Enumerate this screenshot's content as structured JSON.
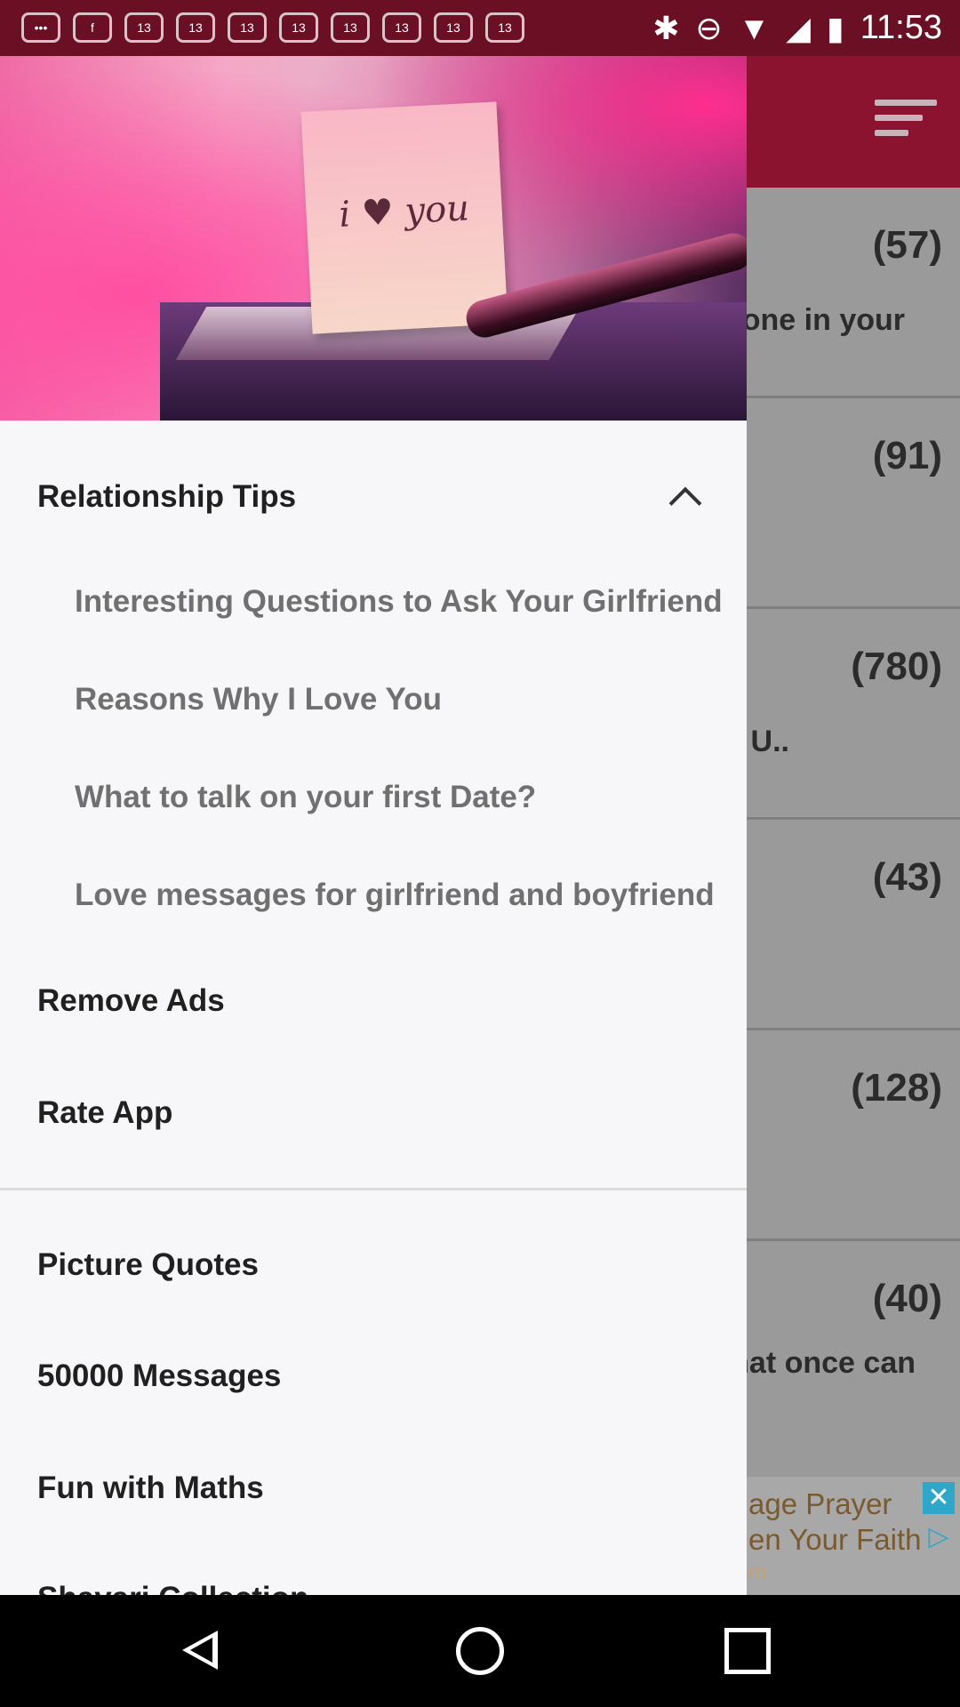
{
  "status_bar": {
    "notification_icons": [
      "more-icon",
      "facebook-icon",
      "abc13-icon",
      "abc13-icon",
      "abc13-icon",
      "abc13-icon",
      "abc13-icon",
      "abc13-icon",
      "abc13-icon",
      "abc13-icon"
    ],
    "notification_label": "13",
    "time": "11:53"
  },
  "background_list": [
    {
      "count": "(57)",
      "snippet": "one in your"
    },
    {
      "count": "(91)",
      "snippet": ""
    },
    {
      "count": "(780)",
      "snippet": "U.."
    },
    {
      "count": "(43)",
      "snippet": ""
    },
    {
      "count": "(128)",
      "snippet": ""
    },
    {
      "count": "(40)",
      "snippet": "hat once can"
    }
  ],
  "ad": {
    "line1": "age Prayer",
    "line2": "en Your Faith",
    "line3": "m"
  },
  "drawer": {
    "hero_note_text": "i ♥ you",
    "section_title": "Relationship Tips",
    "sub_items": [
      "Interesting Questions to Ask Your Girlfriend",
      "Reasons Why I Love You",
      "What to talk on your first Date?",
      "Love messages for girlfriend and boyfriend"
    ],
    "remove_ads": "Remove Ads",
    "rate_app": "Rate App",
    "apps": [
      "Picture Quotes",
      "50000 Messages",
      "Fun with Maths",
      "Shayari Collection"
    ]
  },
  "colors": {
    "status_bar": "#6b1024",
    "app_bar": "#8b1330",
    "drawer_bg": "#f7f7f9"
  }
}
